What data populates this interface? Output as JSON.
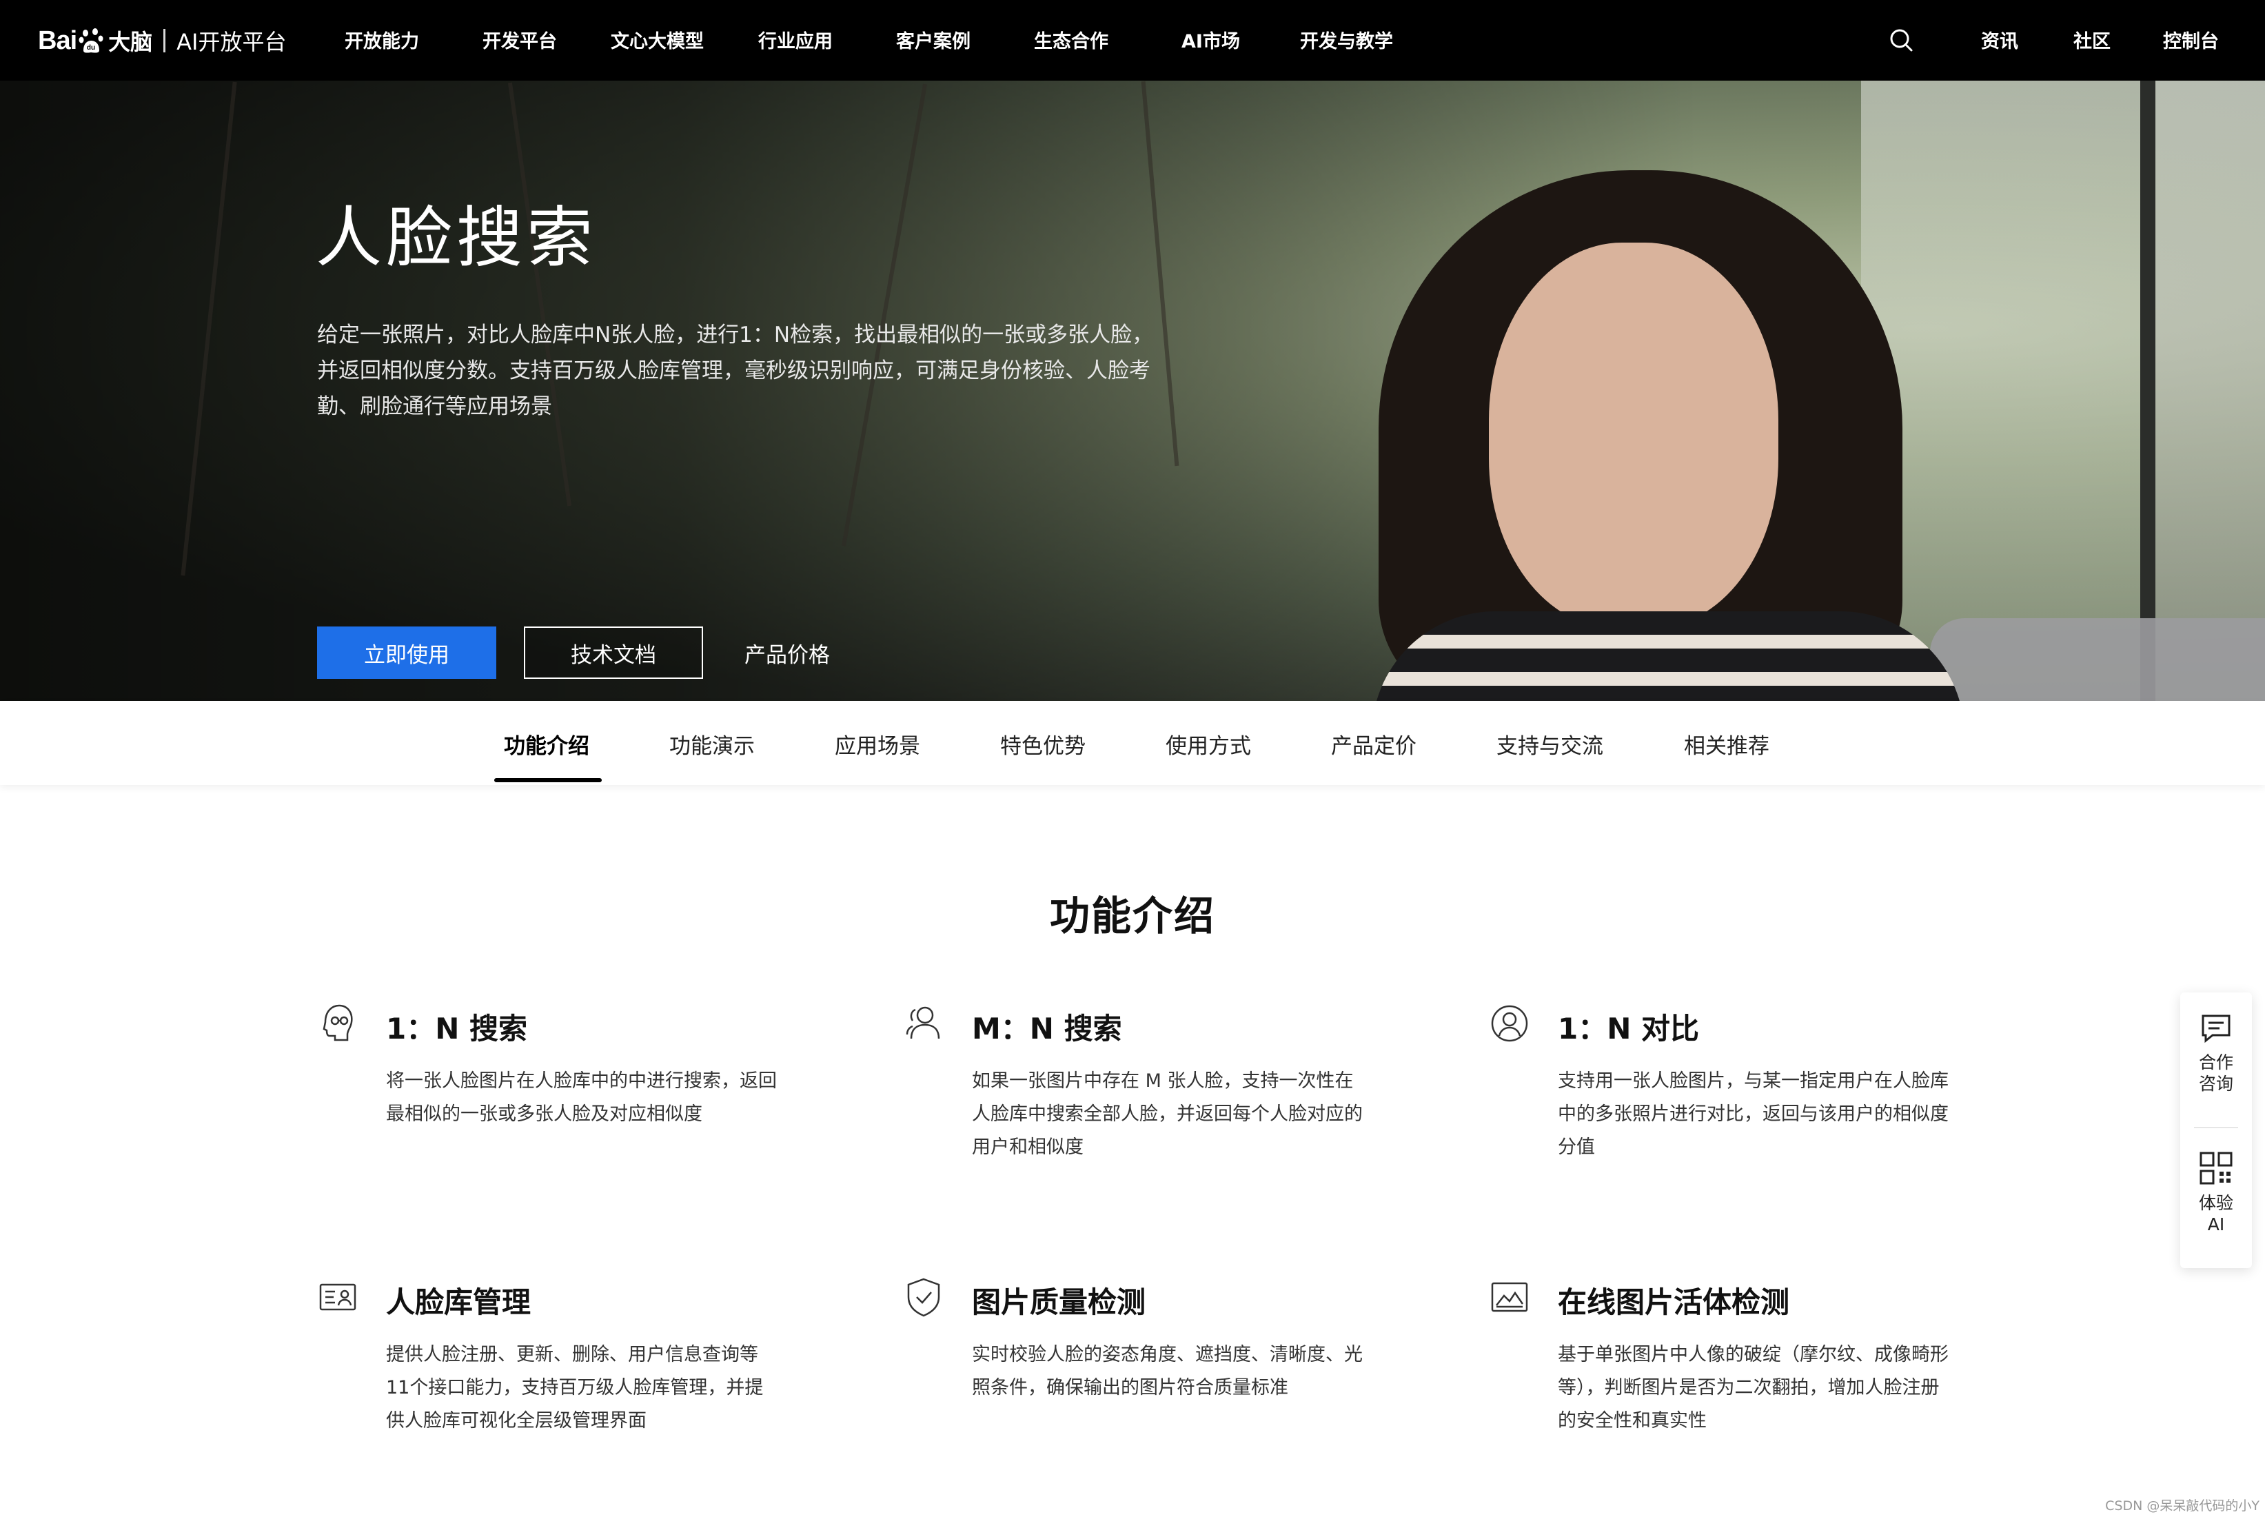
{
  "brand": {
    "logo_bai": "Bai",
    "logo_du_cn": "大脑",
    "logo_sub": "AI开放平台"
  },
  "nav": {
    "items": [
      "开放能力",
      "开发平台",
      "文心大模型",
      "行业应用",
      "客户案例",
      "生态合作",
      "AI市场",
      "开发与教学"
    ],
    "right": [
      "资讯",
      "社区",
      "控制台"
    ],
    "search_icon": "search-icon"
  },
  "hero": {
    "title": "人脸搜索",
    "description": "给定一张照片，对比人脸库中N张人脸，进行1：N检索，找出最相似的一张或多张人脸，并返回相似度分数。支持百万级人脸库管理，毫秒级识别响应，可满足身份核验、人脸考勤、刷脸通行等应用场景",
    "primary_button": "立即使用",
    "secondary_button": "技术文档",
    "price_link": "产品价格"
  },
  "tabs": [
    "功能介绍",
    "功能演示",
    "应用场景",
    "特色优势",
    "使用方式",
    "产品定价",
    "支持与交流",
    "相关推荐"
  ],
  "section": {
    "title": "功能介绍",
    "features": [
      {
        "icon": "face-search-icon",
        "title": "1：N 搜索",
        "desc": "将一张人脸图片在人脸库中的中进行搜索，返回最相似的一张或多张人脸及对应相似度"
      },
      {
        "icon": "multi-user-icon",
        "title": "M：N 搜索",
        "desc": "如果一张图片中存在 M 张人脸，支持一次性在人脸库中搜索全部人脸，并返回每个人脸对应的用户和相似度"
      },
      {
        "icon": "user-circle-icon",
        "title": "1：N 对比",
        "desc": "支持用一张人脸图片，与某一指定用户在人脸库中的多张照片进行对比，返回与该用户的相似度分值"
      },
      {
        "icon": "id-card-icon",
        "title": "人脸库管理",
        "desc": "提供人脸注册、更新、删除、用户信息查询等11个接口能力，支持百万级人脸库管理，并提供人脸库可视化全层级管理界面"
      },
      {
        "icon": "shield-check-icon",
        "title": "图片质量检测",
        "desc": "实时校验人脸的姿态角度、遮挡度、清晰度、光照条件，确保输出的图片符合质量标准"
      },
      {
        "icon": "image-frame-icon",
        "title": "在线图片活体检测",
        "desc": "基于单张图片中人像的破绽（摩尔纹、成像畸形等），判断图片是否为二次翻拍，增加人脸注册的安全性和真实性"
      }
    ]
  },
  "side_panel": {
    "consult_label_1": "合作",
    "consult_label_2": "咨询",
    "try_label_1": "体验",
    "try_label_2": "AI"
  },
  "watermark": "CSDN @呆呆敲代码的小Y",
  "colors": {
    "primary": "#1e6fe8",
    "nav_bg": "#000000"
  }
}
